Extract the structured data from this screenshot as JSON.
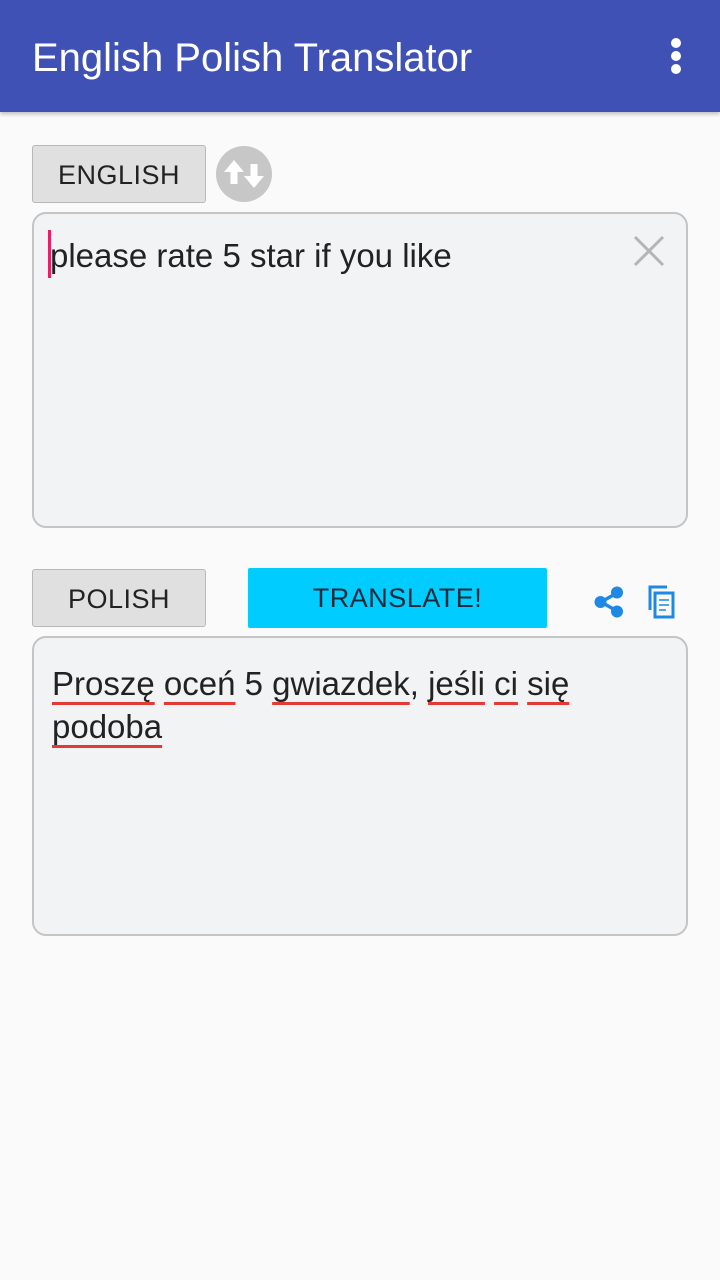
{
  "app_bar": {
    "title": "English Polish Translator",
    "menu_icon": "more-vert-icon",
    "background": "#3f51b5"
  },
  "source": {
    "language_label": "ENGLISH",
    "swap_icon": "swap-arrows-icon",
    "input_value": "please rate 5 star if you like",
    "clear_icon": "close-icon"
  },
  "target": {
    "language_label": "POLISH",
    "translate_label": "TRANSLATE!",
    "translate_color": "#00ccff",
    "share_icon": "share-icon",
    "copy_icon": "copy-icon",
    "output_words": [
      {
        "text": "Proszę",
        "misspelled": true
      },
      {
        "text": "oceń",
        "misspelled": true
      },
      {
        "text": "5",
        "misspelled": false
      },
      {
        "text": "gwiazdek",
        "misspelled": true
      },
      {
        "text": ",",
        "misspelled": false
      },
      {
        "text": "jeśli",
        "misspelled": true
      },
      {
        "text": "ci",
        "misspelled": true
      },
      {
        "text": "się",
        "misspelled": true
      },
      {
        "text": "podoba",
        "misspelled": true
      }
    ]
  },
  "accent_color": "#e91e63",
  "spellcheck_color": "#e53935"
}
